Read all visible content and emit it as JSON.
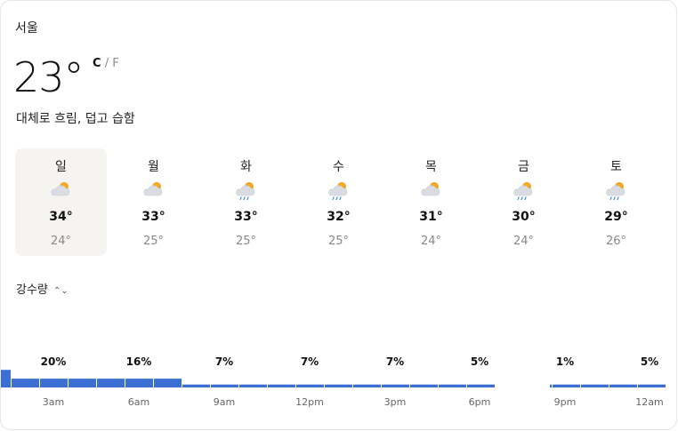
{
  "location": "서울",
  "current": {
    "temperature": "23°",
    "unit_c": "C",
    "unit_sep": "/",
    "unit_f": "F",
    "condition": "대체로 흐림, 덥고 습함"
  },
  "forecast": [
    {
      "day": "일",
      "icon": "partly-cloudy-icon",
      "high": "34°",
      "low": "24°",
      "selected": true
    },
    {
      "day": "월",
      "icon": "partly-cloudy-icon",
      "high": "33°",
      "low": "25°",
      "selected": false
    },
    {
      "day": "화",
      "icon": "rain-cloud-icon",
      "high": "33°",
      "low": "25°",
      "selected": false
    },
    {
      "day": "수",
      "icon": "rain-cloud-icon",
      "high": "32°",
      "low": "25°",
      "selected": false
    },
    {
      "day": "목",
      "icon": "partly-cloudy-icon",
      "high": "31°",
      "low": "24°",
      "selected": false
    },
    {
      "day": "금",
      "icon": "rain-cloud-icon",
      "high": "30°",
      "low": "24°",
      "selected": false
    },
    {
      "day": "토",
      "icon": "rain-cloud-icon",
      "high": "29°",
      "low": "26°",
      "selected": false
    }
  ],
  "metric_selector": {
    "label": "강수량",
    "icon": "chevron-updown-icon"
  },
  "colors": {
    "bar": "#3b6fd4",
    "selected_bg": "#f5f4f0",
    "muted": "#8a8a8a",
    "sun": "#f5a623",
    "cloud": "#d9dde3",
    "rain": "#4a90e2"
  },
  "chart_data": {
    "type": "bar",
    "series_name": "precipitation_percent",
    "hourly_percent": [
      6,
      3,
      3,
      3,
      3,
      3,
      3,
      1,
      1,
      1,
      1,
      1,
      1,
      1,
      1,
      1,
      1,
      1,
      1,
      1,
      1,
      1,
      1,
      1
    ],
    "value_labels": [
      "20%",
      "16%",
      "7%",
      "7%",
      "7%",
      "5%",
      "1%",
      "5%"
    ],
    "x_tick_labels": [
      "3am",
      "6am",
      "9am",
      "12pm",
      "3pm",
      "6pm",
      "9pm",
      "12am"
    ]
  }
}
